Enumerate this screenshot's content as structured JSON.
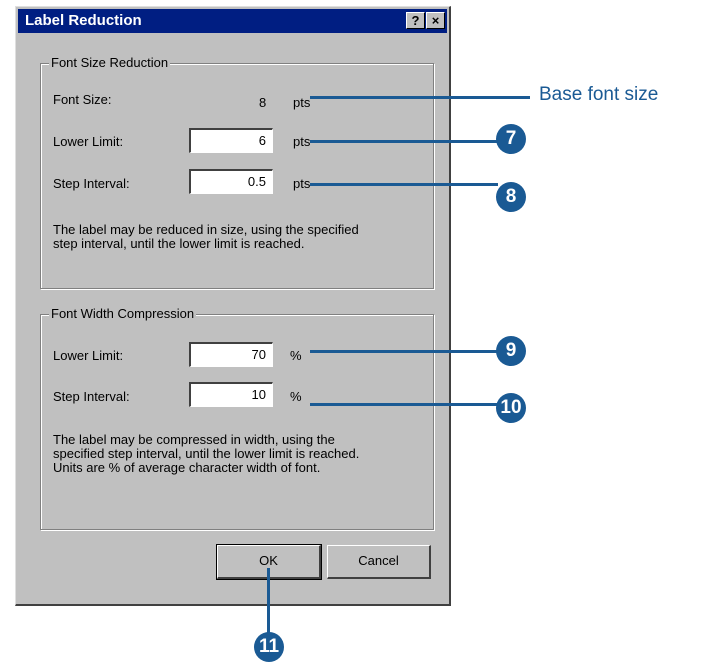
{
  "window": {
    "title": "Label Reduction",
    "help_label": "?",
    "close_label": "×"
  },
  "font_size_reduction": {
    "title": "Font Size Reduction",
    "font_size_label": "Font Size:",
    "font_size_value": "8",
    "font_size_unit": "pts",
    "lower_limit_label": "Lower Limit:",
    "lower_limit_value": "6",
    "lower_limit_unit": "pts",
    "step_interval_label": "Step Interval:",
    "step_interval_value": "0.5",
    "step_interval_unit": "pts",
    "description_line1": "The label may be reduced in size, using the specified",
    "description_line2": "step interval, until the lower limit is reached."
  },
  "font_width_compression": {
    "title": "Font Width Compression",
    "lower_limit_label": "Lower Limit:",
    "lower_limit_value": "70",
    "lower_limit_unit": "%",
    "step_interval_label": "Step Interval:",
    "step_interval_value": "10",
    "step_interval_unit": "%",
    "description_line1": "The label may be compressed in width, using the",
    "description_line2": "specified step interval, until the lower limit is reached.",
    "description_line3": "Units are % of average character width of font."
  },
  "buttons": {
    "ok": "OK",
    "cancel": "Cancel"
  },
  "callouts": {
    "base_font_size": "Base font size",
    "step7": "7",
    "step8": "8",
    "step9": "9",
    "step10": "10",
    "step11": "11"
  },
  "colors": {
    "callout": "#1a5a94",
    "titlebar": "#001e82",
    "dialog_face": "#c0c0c0"
  }
}
